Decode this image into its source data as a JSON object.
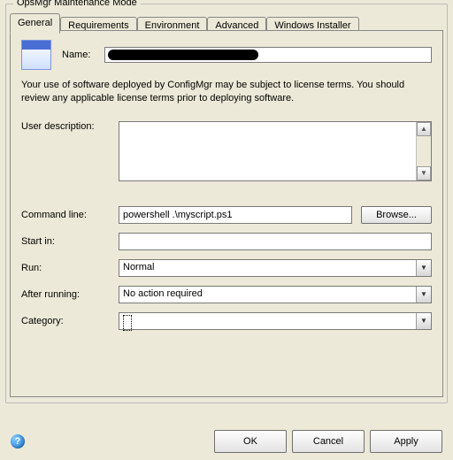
{
  "window": {
    "title": "OpsMgr Maintenance Mode"
  },
  "tabs": {
    "items": [
      "General",
      "Requirements",
      "Environment",
      "Advanced",
      "Windows Installer"
    ],
    "active": 0
  },
  "general": {
    "name_label": "Name:",
    "name_value": "",
    "notice": "Your use of software deployed by ConfigMgr may be subject to license terms. You should review any applicable license terms prior to deploying software.",
    "user_desc_label": "User description:",
    "user_desc_value": "",
    "cmd_label": "Command line:",
    "cmd_value": "powershell .\\myscript.ps1",
    "browse_label": "Browse...",
    "startin_label": "Start in:",
    "startin_value": "",
    "run_label": "Run:",
    "run_value": "Normal",
    "after_label": "After running:",
    "after_value": "No action required",
    "category_label": "Category:",
    "category_value": ""
  },
  "buttons": {
    "ok": "OK",
    "cancel": "Cancel",
    "apply": "Apply"
  },
  "icons": {
    "up": "▲",
    "down": "▼",
    "help": "?"
  }
}
